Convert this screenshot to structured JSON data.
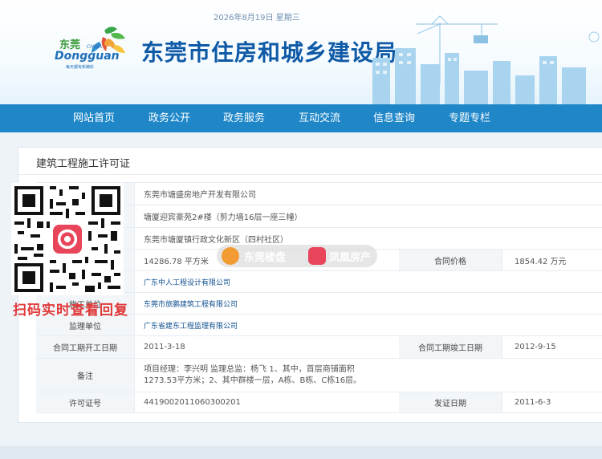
{
  "header": {
    "date": "2026年8月19日 星期三",
    "site_title": "东莞市住房和城乡建设局",
    "logo": {
      "cn": "东莞",
      "en": "Dongguan",
      "china": "CHINA",
      "slogan": "每天都有新精彩"
    }
  },
  "nav": {
    "items": [
      "网站首页",
      "政务公开",
      "政务服务",
      "互动交流",
      "信息查询",
      "专题专栏"
    ]
  },
  "panel": {
    "title": "建筑工程施工许可证",
    "rows": {
      "builder": {
        "value": "东莞市塘盛房地产开发有限公司"
      },
      "project": {
        "value": "塘厦迎宾豪苑2#楼（剪力墙16层一座三幢）"
      },
      "address": {
        "value": "东莞市塘厦镇行政文化新区（四村社区）"
      },
      "area": {
        "value": "14286.78 平方米",
        "label2": "合同价格",
        "value2": "1854.42 万元"
      },
      "design": {
        "value": "广东中人工程设计有限公司"
      },
      "construction": {
        "label": "施工单位",
        "value": "东莞市旅鹏建筑工程有限公司"
      },
      "supervision": {
        "label": "监理单位",
        "value": "广东省建东工程监理有限公司"
      },
      "start": {
        "label": "合同工期开工日期",
        "value": "2011-3-18",
        "label2": "合同工期竣工日期",
        "value2": "2012-9-15"
      },
      "remark": {
        "label": "备注",
        "value": "项目经理：李兴明 监理总监：杨飞 1、其中，首层商铺面积1273.53平方米；2、其中群楼一层，A栋、B栋、C栋16层。"
      },
      "permit": {
        "label": "许可证号",
        "value": "441900201106030020​1",
        "label2": "发证日期",
        "value2": "2011-6-3"
      }
    }
  },
  "overlay": {
    "qr_caption": "扫码实时查看回复",
    "watermark_left": "东莞楼盘",
    "watermark_right": "凤凰房产"
  }
}
